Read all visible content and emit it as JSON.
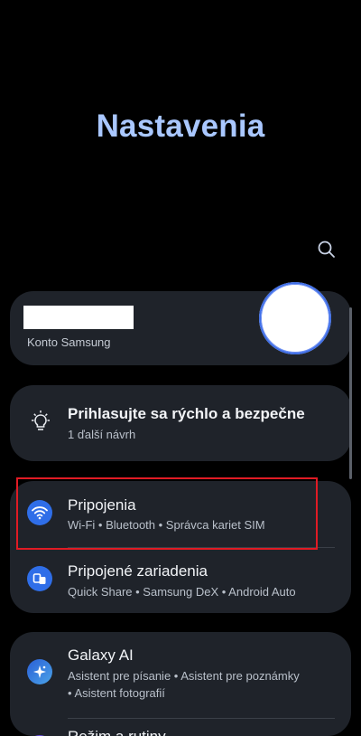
{
  "page": {
    "title": "Nastavenia"
  },
  "account": {
    "label": "Konto Samsung"
  },
  "suggestion": {
    "title": "Prihlasujte sa rýchlo a bezpečne",
    "subtitle": "1 ďalší návrh"
  },
  "items": [
    {
      "title": "Pripojenia",
      "subtitle": "Wi-Fi  •  Bluetooth  •  Správca kariet SIM",
      "icon": "wifi-icon",
      "color": "#2f6ee8"
    },
    {
      "title": "Pripojené zariadenia",
      "subtitle": "Quick Share  •  Samsung DeX  •  Android Auto",
      "icon": "devices-icon",
      "color": "#2f6ee8"
    },
    {
      "title": "Galaxy AI",
      "subtitle": "Asistent pre písanie  •  Asistent pre poznámky",
      "subtitle2": "•  Asistent fotografií",
      "icon": "galaxy-ai-icon",
      "color": "#2a5fd6"
    },
    {
      "title": "Režim a rutiny",
      "icon": "modes-icon",
      "color": "#6a4de0"
    }
  ],
  "colors": {
    "accent": "#a9c7ff",
    "highlight": "#e01b24",
    "card": "#1f232a"
  }
}
